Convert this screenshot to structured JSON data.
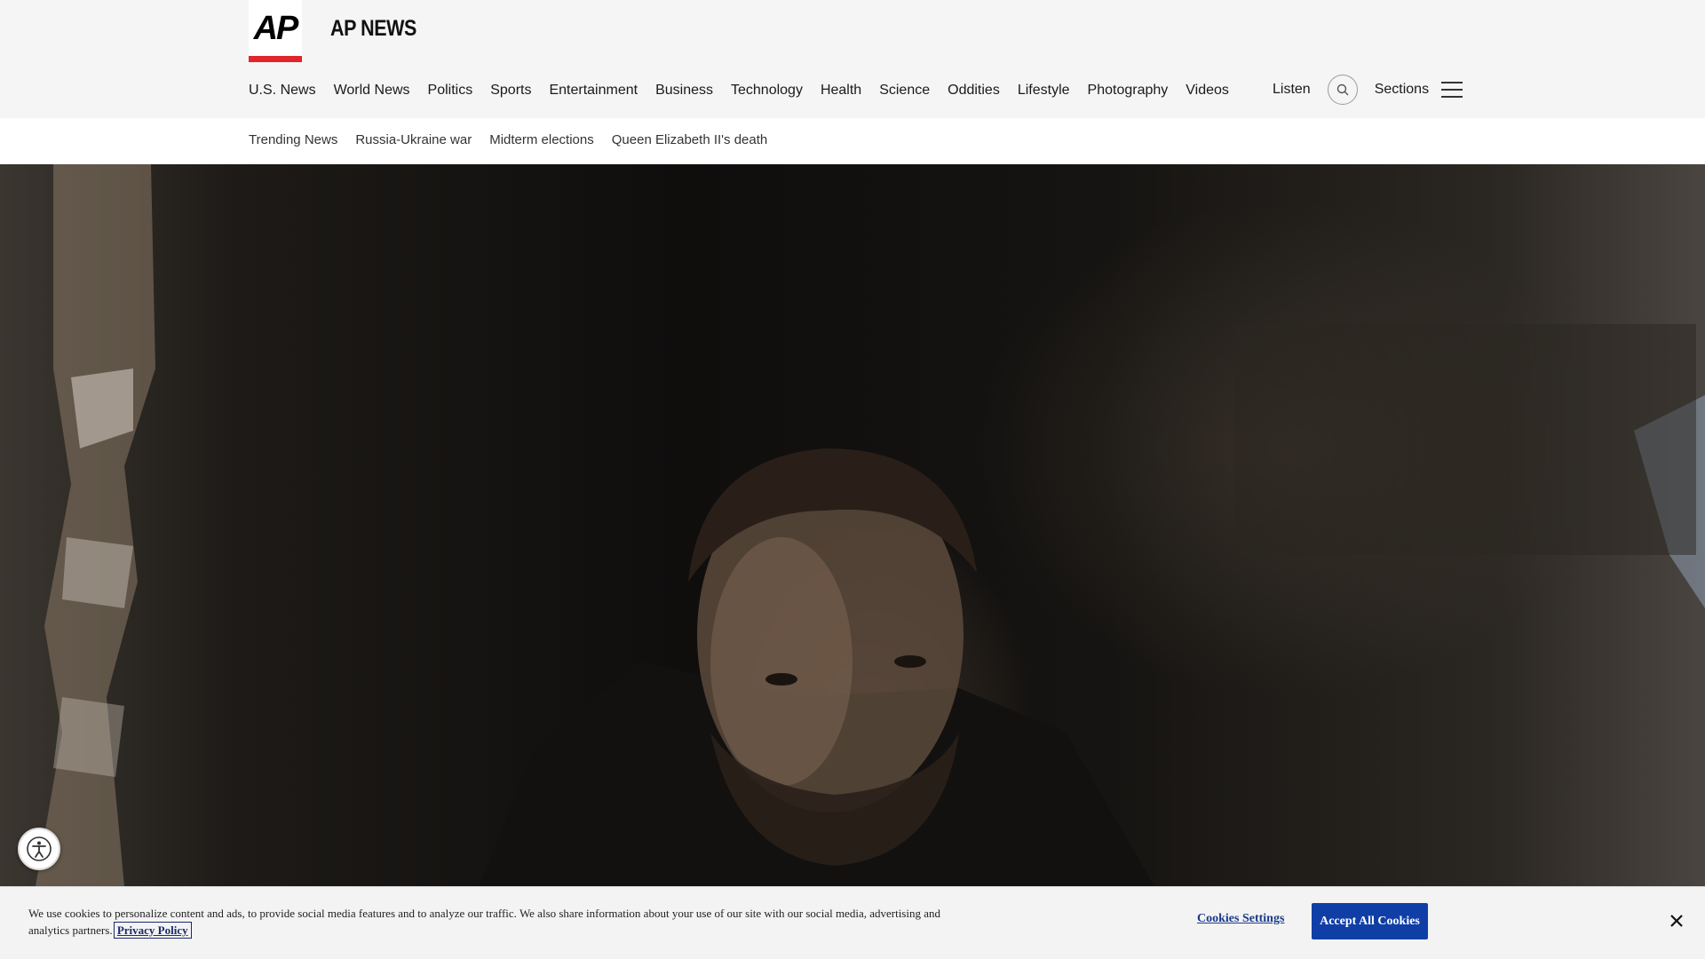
{
  "brand": {
    "logo_text": "AP",
    "name": "AP NEWS",
    "accent_color": "#e0252b"
  },
  "main_nav": {
    "items": [
      {
        "label": "U.S. News"
      },
      {
        "label": "World News"
      },
      {
        "label": "Politics"
      },
      {
        "label": "Sports"
      },
      {
        "label": "Entertainment"
      },
      {
        "label": "Business"
      },
      {
        "label": "Technology"
      },
      {
        "label": "Health"
      },
      {
        "label": "Science"
      },
      {
        "label": "Oddities"
      },
      {
        "label": "Lifestyle"
      },
      {
        "label": "Photography"
      },
      {
        "label": "Videos"
      }
    ],
    "listen_label": "Listen",
    "search_icon": "search-icon",
    "sections_label": "Sections",
    "menu_icon": "hamburger-icon"
  },
  "trending": {
    "items": [
      {
        "label": "Trending News"
      },
      {
        "label": "Russia-Ukraine war"
      },
      {
        "label": "Midterm elections"
      },
      {
        "label": "Queen Elizabeth II's death"
      }
    ]
  },
  "hero": {
    "icon": "photo"
  },
  "accessibility": {
    "icon": "accessibility-icon"
  },
  "cookie_banner": {
    "text": "We use cookies to personalize content and ads, to provide social media features and to analyze our traffic. We also share information about your use of our site with our social media, advertising and analytics partners.",
    "privacy_link": "Privacy Policy",
    "settings_label": "Cookies Settings",
    "accept_label": "Accept All Cookies",
    "accept_color": "#0f3ea6",
    "close_icon": "close-icon"
  }
}
